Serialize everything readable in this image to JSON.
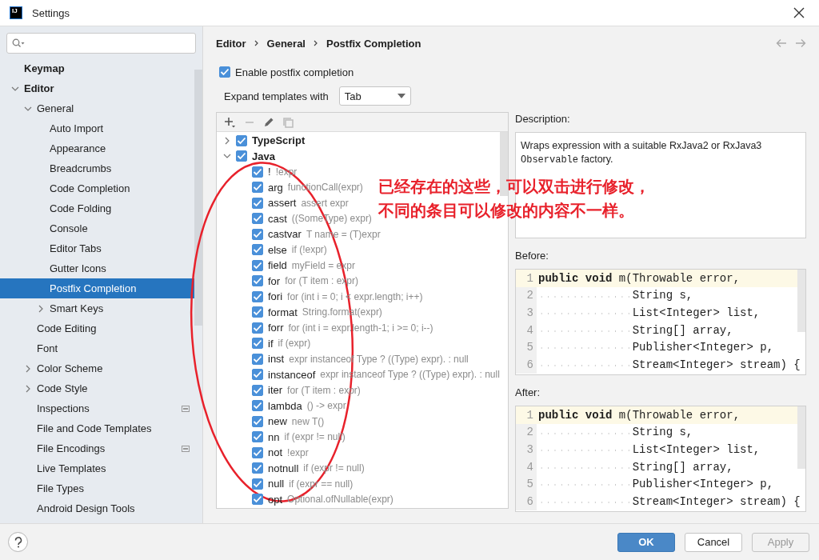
{
  "window": {
    "title": "Settings",
    "logo_text": "IJ"
  },
  "sidebar": {
    "items": [
      {
        "label": "Keymap",
        "selected": false
      },
      {
        "label": "Editor",
        "selected": false,
        "expanded": true,
        "children": [
          {
            "label": "General",
            "selected": false,
            "expanded": true,
            "children": [
              {
                "label": "Auto Import",
                "selected": false
              },
              {
                "label": "Appearance",
                "selected": false
              },
              {
                "label": "Breadcrumbs",
                "selected": false
              },
              {
                "label": "Code Completion",
                "selected": false
              },
              {
                "label": "Code Folding",
                "selected": false
              },
              {
                "label": "Console",
                "selected": false
              },
              {
                "label": "Editor Tabs",
                "selected": false
              },
              {
                "label": "Gutter Icons",
                "selected": false
              },
              {
                "label": "Postfix Completion",
                "selected": true
              },
              {
                "label": "Smart Keys",
                "selected": false,
                "expanded": false
              }
            ]
          },
          {
            "label": "Code Editing",
            "selected": false
          },
          {
            "label": "Font",
            "selected": false
          },
          {
            "label": "Color Scheme",
            "selected": false,
            "expanded": false
          },
          {
            "label": "Code Style",
            "selected": false,
            "expanded": false
          },
          {
            "label": "Inspections",
            "selected": false,
            "project_scoped": true
          },
          {
            "label": "File and Code Templates",
            "selected": false
          },
          {
            "label": "File Encodings",
            "selected": false,
            "project_scoped": true
          },
          {
            "label": "Live Templates",
            "selected": false
          },
          {
            "label": "File Types",
            "selected": false
          },
          {
            "label": "Android Design Tools",
            "selected": false
          }
        ]
      }
    ]
  },
  "breadcrumbs": [
    "Editor",
    "General",
    "Postfix Completion"
  ],
  "enable_postfix": {
    "label": "Enable postfix completion",
    "checked": true
  },
  "expand_with": {
    "label": "Expand templates with",
    "value": "Tab"
  },
  "templates": [
    {
      "name": "TypeScript",
      "checked": true,
      "expanded": false
    },
    {
      "name": "Java",
      "checked": true,
      "expanded": true,
      "children": [
        {
          "name": "!",
          "example": "!expr",
          "checked": true
        },
        {
          "name": "arg",
          "example": "functionCall(expr)",
          "checked": true
        },
        {
          "name": "assert",
          "example": "assert expr",
          "checked": true
        },
        {
          "name": "cast",
          "example": "((SomeType) expr)",
          "checked": true
        },
        {
          "name": "castvar",
          "example": "T name = (T)expr",
          "checked": true
        },
        {
          "name": "else",
          "example": "if (!expr)",
          "checked": true
        },
        {
          "name": "field",
          "example": "myField = expr",
          "checked": true
        },
        {
          "name": "for",
          "example": "for (T item : expr)",
          "checked": true
        },
        {
          "name": "fori",
          "example": "for (int i = 0; i < expr.length; i++)",
          "checked": true
        },
        {
          "name": "format",
          "example": "String.format(expr)",
          "checked": true
        },
        {
          "name": "forr",
          "example": "for (int i = expr.length-1; i >= 0; i--)",
          "checked": true
        },
        {
          "name": "if",
          "example": "if (expr)",
          "checked": true
        },
        {
          "name": "inst",
          "example": "expr instanceof Type ? ((Type) expr). : null",
          "checked": true
        },
        {
          "name": "instanceof",
          "example": "expr instanceof Type ? ((Type) expr). : null",
          "checked": true
        },
        {
          "name": "iter",
          "example": "for (T item : expr)",
          "checked": true
        },
        {
          "name": "lambda",
          "example": "() -> expr",
          "checked": true
        },
        {
          "name": "new",
          "example": "new T()",
          "checked": true
        },
        {
          "name": "nn",
          "example": "if (expr != null)",
          "checked": true
        },
        {
          "name": "not",
          "example": "!expr",
          "checked": true
        },
        {
          "name": "notnull",
          "example": "if (expr != null)",
          "checked": true
        },
        {
          "name": "null",
          "example": "if (expr == null)",
          "checked": true
        },
        {
          "name": "opt",
          "example": "Optional.ofNullable(expr)",
          "checked": true
        }
      ]
    }
  ],
  "description": {
    "label": "Description:",
    "parts": [
      {
        "kind": "text",
        "text": "Wraps expression with a suitable RxJava2 or RxJava3 "
      },
      {
        "kind": "code",
        "text": "Observable"
      },
      {
        "kind": "text",
        "text": " factory."
      }
    ]
  },
  "before": {
    "label": "Before:",
    "lines": [
      {
        "number": "1",
        "current": true,
        "code": "**public** **void** m(Throwable error,"
      },
      {
        "number": "2",
        "current": false,
        "code": "              String s,"
      },
      {
        "number": "3",
        "current": false,
        "code": "              List<Integer> list,"
      },
      {
        "number": "4",
        "current": false,
        "code": "              String[] array,"
      },
      {
        "number": "5",
        "current": false,
        "code": "              Publisher<Integer> p,"
      },
      {
        "number": "6",
        "current": false,
        "code": "              Stream<Integer> stream) {"
      }
    ]
  },
  "after": {
    "label": "After:",
    "lines": [
      {
        "number": "1",
        "current": true,
        "code": "**public** **void** m(Throwable error,"
      },
      {
        "number": "2",
        "current": false,
        "code": "              String s,"
      },
      {
        "number": "3",
        "current": false,
        "code": "              List<Integer> list,"
      },
      {
        "number": "4",
        "current": false,
        "code": "              String[] array,"
      },
      {
        "number": "5",
        "current": false,
        "code": "              Publisher<Integer> p,"
      },
      {
        "number": "6",
        "current": false,
        "code": "              Stream<Integer> stream) {"
      }
    ]
  },
  "annotation": {
    "lines": [
      "已经存在的这些，可以双击进行修改，",
      "不同的条目可以修改的内容不一样。"
    ]
  },
  "buttons": [
    {
      "label": "OK",
      "kind": "primary",
      "disabled": false
    },
    {
      "label": "Cancel",
      "kind": "normal",
      "disabled": false
    },
    {
      "label": "Apply",
      "kind": "normal",
      "disabled": true
    }
  ]
}
